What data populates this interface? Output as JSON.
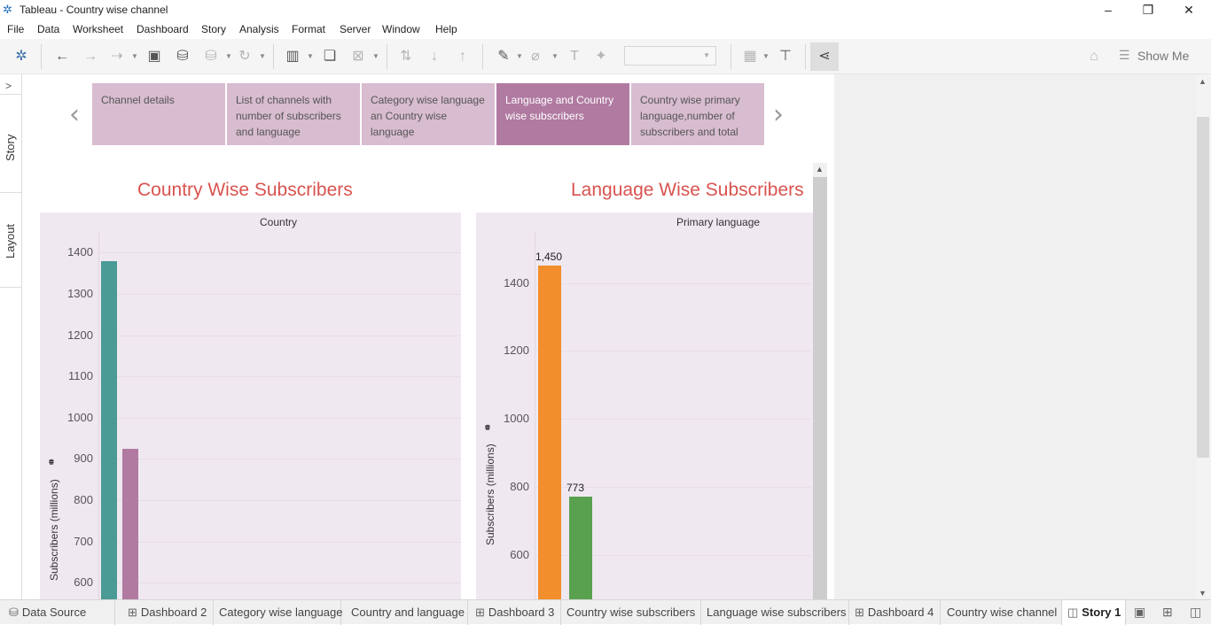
{
  "window": {
    "title": "Tableau - Country wise channel"
  },
  "menu": [
    "File",
    "Data",
    "Worksheet",
    "Dashboard",
    "Story",
    "Analysis",
    "Format",
    "Server",
    "Window",
    "Help"
  ],
  "toolbar": {
    "show_me_label": "Show Me"
  },
  "left_rail": {
    "story_label": "Story",
    "layout_label": "Layout"
  },
  "story_points": [
    {
      "label": "Channel details"
    },
    {
      "label": "List of channels with number of subscribers and language"
    },
    {
      "label": "Category wise language an Country wise language"
    },
    {
      "label": "Language and Country wise subscribers",
      "active": true
    },
    {
      "label": "Country wise primary language,number of subscribers and total"
    }
  ],
  "colors": {
    "teal": "#4a9a96",
    "purple": "#b07aa1",
    "orange": "#f28e2b",
    "green": "#59a14f",
    "title_red": "#d9534f",
    "story_active": "#b07aa1",
    "story_inactive": "#d8bcd0"
  },
  "chart_data": [
    {
      "type": "bar",
      "title": "Country Wise Subscribers",
      "header": "Country",
      "ylabel": "Subscribers (millions)",
      "ylim": [
        560,
        1450
      ],
      "yticks": [
        600,
        700,
        800,
        900,
        1000,
        1100,
        1200,
        1300,
        1400
      ],
      "values": [
        1380,
        925
      ],
      "colors": [
        "#4a9a96",
        "#b07aa1"
      ]
    },
    {
      "type": "bar",
      "title": "Language Wise Subscribers",
      "header": "Primary language",
      "ylabel": "Subscribers (millions)",
      "ylim": [
        470,
        1550
      ],
      "yticks": [
        600,
        800,
        1000,
        1200,
        1400
      ],
      "values": [
        1450,
        773
      ],
      "data_labels": [
        "1,450",
        "773"
      ],
      "colors": [
        "#f28e2b",
        "#59a14f"
      ]
    }
  ],
  "tabs": [
    {
      "label": "Data Source",
      "icon": "datasource-icon"
    },
    {
      "label": "Dashboard 2",
      "icon": "dashboard-icon"
    },
    {
      "label": "Category wise language"
    },
    {
      "label": "Country and language"
    },
    {
      "label": "Dashboard 3",
      "icon": "dashboard-icon"
    },
    {
      "label": "Country wise subscribers"
    },
    {
      "label": "Language wise subscribers"
    },
    {
      "label": "Dashboard 4",
      "icon": "dashboard-icon"
    },
    {
      "label": "Country wise channel"
    },
    {
      "label": "Story 1",
      "icon": "story-icon",
      "active": true
    }
  ]
}
